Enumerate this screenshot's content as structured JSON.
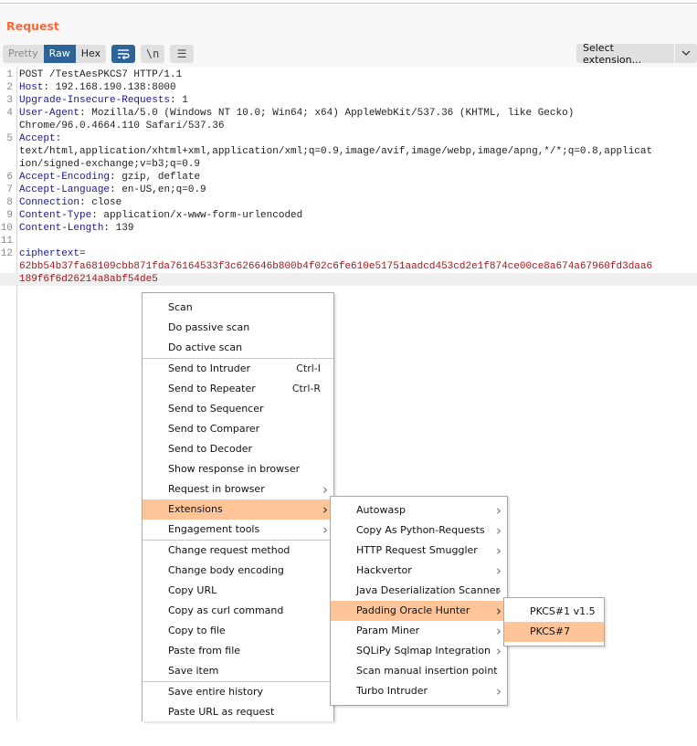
{
  "panel": {
    "title": "Request",
    "view_tabs": [
      {
        "label": "Pretty",
        "active": false
      },
      {
        "label": "Raw",
        "active": true
      },
      {
        "label": "Hex",
        "active": false
      }
    ],
    "toolbar_icons": [
      {
        "name": "wrap-lines-icon",
        "glyph": "⤶",
        "active": true
      },
      {
        "name": "newline-icon",
        "glyph": "\\n",
        "active": false
      },
      {
        "name": "menu-icon",
        "glyph": "☰",
        "active": false
      }
    ],
    "select_extension": {
      "label": "Select extension...",
      "chevron": "⌄"
    }
  },
  "editor": {
    "lines": [
      {
        "num": "1",
        "key": "",
        "sep": "",
        "value": "POST /TestAesPKCS7 HTTP/1.1"
      },
      {
        "num": "2",
        "key": "Host",
        "sep": ": ",
        "value": "192.168.190.138:8000"
      },
      {
        "num": "3",
        "key": "Upgrade-Insecure-Requests",
        "sep": ": ",
        "value": "1"
      },
      {
        "num": "4",
        "key": "User-Agent",
        "sep": ": ",
        "value": "Mozilla/5.0 (Windows NT 10.0; Win64; x64) AppleWebKit/537.36 (KHTML, like Gecko)"
      },
      {
        "num": "",
        "key": "",
        "sep": "",
        "value": "Chrome/96.0.4664.110 Safari/537.36"
      },
      {
        "num": "5",
        "key": "Accept",
        "sep": ":",
        "value": ""
      },
      {
        "num": "",
        "key": "",
        "sep": "",
        "value": "text/html,application/xhtml+xml,application/xml;q=0.9,image/avif,image/webp,image/apng,*/*;q=0.8,applicat"
      },
      {
        "num": "",
        "key": "",
        "sep": "",
        "value": "ion/signed-exchange;v=b3;q=0.9"
      },
      {
        "num": "6",
        "key": "Accept-Encoding",
        "sep": ": ",
        "value": "gzip, deflate"
      },
      {
        "num": "7",
        "key": "Accept-Language",
        "sep": ": ",
        "value": "en-US,en;q=0.9"
      },
      {
        "num": "8",
        "key": "Connection",
        "sep": ": ",
        "value": "close"
      },
      {
        "num": "9",
        "key": "Content-Type",
        "sep": ": ",
        "value": "application/x-www-form-urlencoded"
      },
      {
        "num": "10",
        "key": "Content-Length",
        "sep": ": ",
        "value": "139"
      },
      {
        "num": "11",
        "key": "",
        "sep": "",
        "value": ""
      },
      {
        "num": "12",
        "key": "ciphertext",
        "sep": "=",
        "value": ""
      }
    ],
    "body_lines": [
      "62bb54b37fa68109cbb871fda76164533f3c626646b800b4f02c6fe610e51751aadcd453cd2e1f874ce00ce8a674a67960fd3daa6",
      "189f6f6d26214a8abf54de5"
    ]
  },
  "context_menu": {
    "groups": [
      [
        {
          "label": "Scan"
        },
        {
          "label": "Do passive scan"
        },
        {
          "label": "Do active scan"
        }
      ],
      [
        {
          "label": "Send to Intruder",
          "shortcut": "Ctrl-I"
        },
        {
          "label": "Send to Repeater",
          "shortcut": "Ctrl-R"
        },
        {
          "label": "Send to Sequencer"
        },
        {
          "label": "Send to Comparer"
        },
        {
          "label": "Send to Decoder"
        },
        {
          "label": "Show response in browser"
        },
        {
          "label": "Request in browser",
          "submenu": true
        },
        {
          "label": "Extensions",
          "submenu": true,
          "selected": true
        },
        {
          "label": "Engagement tools",
          "submenu": true
        }
      ],
      [
        {
          "label": "Change request method"
        },
        {
          "label": "Change body encoding"
        },
        {
          "label": "Copy URL"
        },
        {
          "label": "Copy as curl command"
        },
        {
          "label": "Copy to file"
        },
        {
          "label": "Paste from file"
        },
        {
          "label": "Save item"
        }
      ],
      [
        {
          "label": "Save entire history"
        },
        {
          "label": "Paste URL as request"
        }
      ]
    ]
  },
  "extensions_menu": {
    "items": [
      {
        "label": "Autowasp",
        "submenu": true
      },
      {
        "label": "Copy As Python-Requests",
        "submenu": true
      },
      {
        "label": "HTTP Request Smuggler",
        "submenu": true
      },
      {
        "label": "Hackvertor",
        "submenu": true
      },
      {
        "label": "Java Deserialization Scanner",
        "submenu": true
      },
      {
        "label": "Padding Oracle Hunter",
        "submenu": true,
        "selected": true
      },
      {
        "label": "Param Miner",
        "submenu": true
      },
      {
        "label": "SQLiPy Sqlmap Integration",
        "submenu": true
      },
      {
        "label": "Scan manual insertion point"
      },
      {
        "label": "Turbo Intruder",
        "submenu": true
      }
    ]
  },
  "padding_oracle_menu": {
    "items": [
      {
        "label": "PKCS#1 v1.5"
      },
      {
        "label": "PKCS#7",
        "selected": true
      }
    ]
  },
  "colors": {
    "title": "#ff6633",
    "active_tab": "#2d6497",
    "menu_selected": "#ffc599",
    "header_key": "#1a1a8c",
    "body_value": "#a4161a"
  }
}
